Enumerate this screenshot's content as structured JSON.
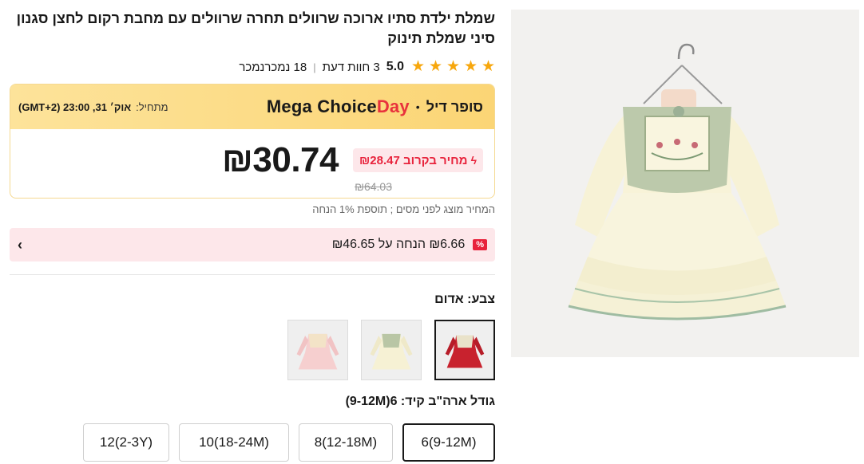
{
  "product": {
    "title": "שמלת ילדת סתיו ארוכה שרוולים תחרה שרוולים עם מחבת רקום לחצן סגנון סיני שמלת תינוק"
  },
  "rating": {
    "score": "5.0",
    "stars": 5,
    "reviews": "3 חוות דעת",
    "separator": "|",
    "sold": "18 נמכרנמכר"
  },
  "deal": {
    "logo_main": "Mega Choice",
    "logo_accent": "Day",
    "dot": "•",
    "name": "סופר דיל",
    "start_label": "מתחיל:",
    "start_time": "אוק׳ 31, 23:00 (GMT+2)"
  },
  "price": {
    "current": "₪30.74",
    "soon_label": "מחיר בקרוב ₪28.47",
    "original": "₪64.03",
    "tax_note": "המחיר מוצג לפני מסים ; תוספת 1% הנחה"
  },
  "coupon": {
    "tag": "%",
    "text": "₪6.66 הנחה על ₪46.65",
    "chevron": "›"
  },
  "color": {
    "label": "צבע: אדום",
    "options": [
      {
        "name": "red",
        "selected": true
      },
      {
        "name": "cream",
        "selected": false
      },
      {
        "name": "pink",
        "selected": false
      }
    ]
  },
  "size": {
    "label": "גודל ארה\"ב קיד: 6(9-12M)",
    "options": [
      {
        "label": "6(9-12M)",
        "selected": true
      },
      {
        "label": "8(12-18M)",
        "selected": false
      },
      {
        "label": "10(18-24M)",
        "selected": false
      },
      {
        "label": "12(2-3Y)",
        "selected": false
      }
    ]
  },
  "colors": {
    "accent": "#e8233c",
    "star": "#f7a70d",
    "deal_bg": "#fcd86b"
  }
}
